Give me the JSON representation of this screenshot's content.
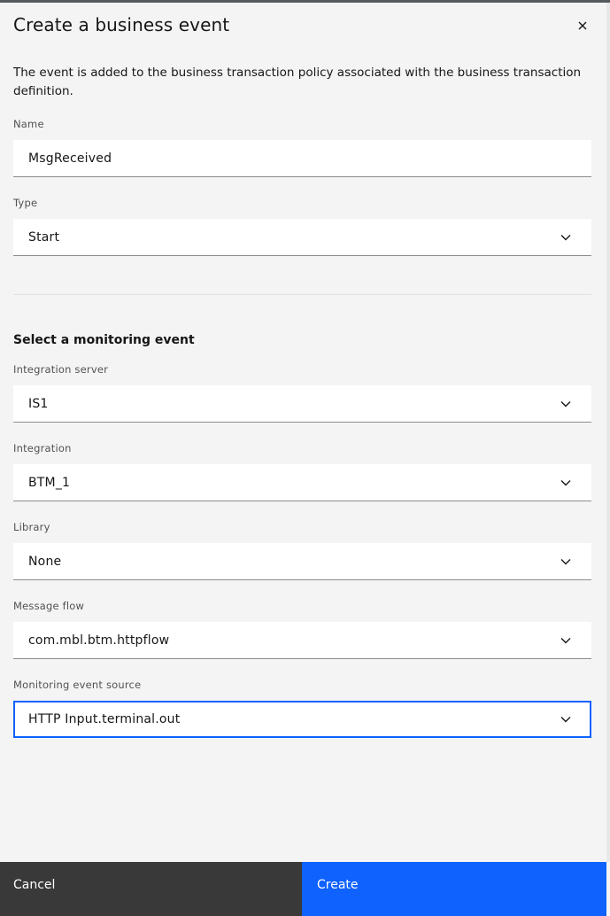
{
  "modal": {
    "title": "Create a business event",
    "description": "The event is added to the business transaction policy associated with the business transaction definition."
  },
  "form": {
    "name": {
      "label": "Name",
      "value": "MsgReceived"
    },
    "type": {
      "label": "Type",
      "value": "Start"
    },
    "monitoring_section": {
      "heading": "Select a monitoring event",
      "integration_server": {
        "label": "Integration server",
        "value": "IS1"
      },
      "integration": {
        "label": "Integration",
        "value": "BTM_1"
      },
      "library": {
        "label": "Library",
        "value": "None"
      },
      "message_flow": {
        "label": "Message flow",
        "value": "com.mbl.btm.httpflow"
      },
      "event_source": {
        "label": "Monitoring event source",
        "value": "HTTP Input.terminal.out"
      }
    }
  },
  "footer": {
    "cancel_label": "Cancel",
    "create_label": "Create"
  },
  "colors": {
    "primary": "#0f62fe",
    "secondary_button": "#393939",
    "background": "#f4f4f4",
    "field_background": "#ffffff"
  },
  "icons": {
    "close": "close-icon",
    "chevron": "chevron-down-icon"
  }
}
